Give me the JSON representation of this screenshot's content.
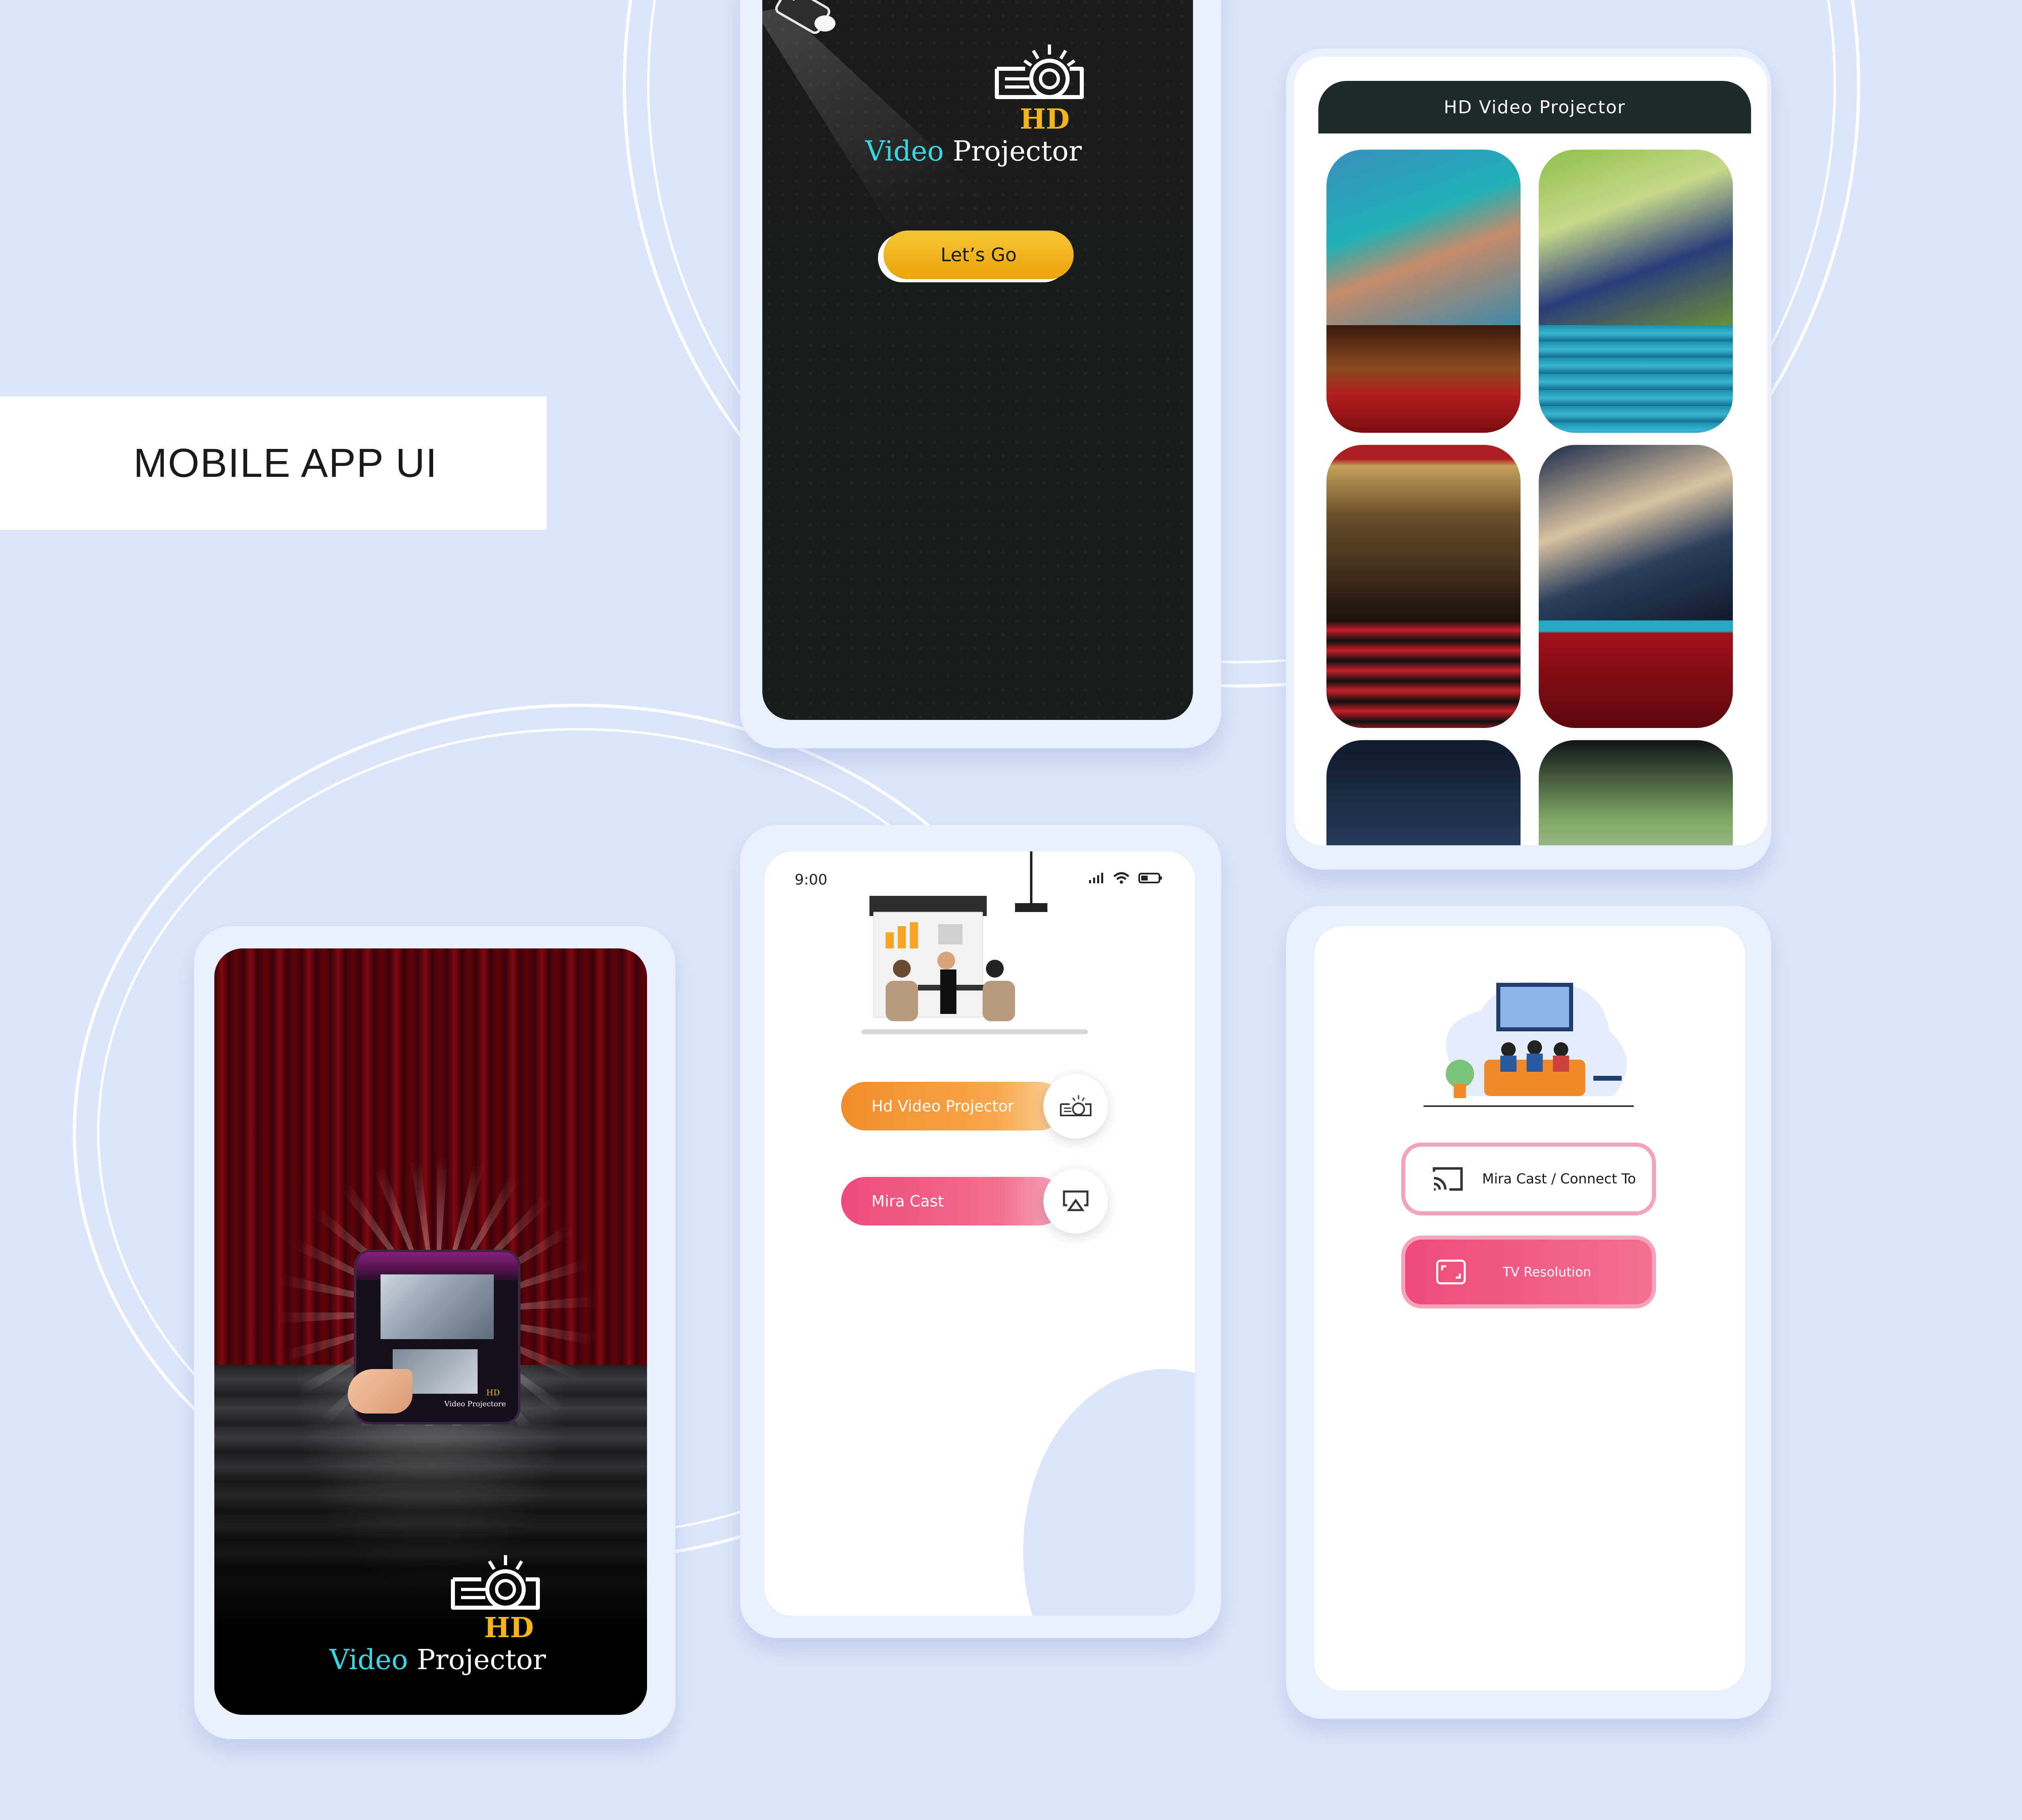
{
  "page": {
    "label": "MOBILE APP UI"
  },
  "splash": {
    "hd": "HD",
    "video": "Video",
    "projector": "Projector",
    "button": "Let’s Go"
  },
  "grid": {
    "title": "HD Video Projector"
  },
  "curtain": {
    "hd": "HD",
    "video": "Video",
    "projector": "Projector",
    "mini_label": "Video Projectore",
    "mini_hd": "HD"
  },
  "menu": {
    "time": "9:00",
    "items": [
      {
        "label": "Hd Video Projector",
        "icon": "projector-icon",
        "color": "#f28c2b"
      },
      {
        "label": "Mira Cast",
        "icon": "airplay-icon",
        "color": "#ee4a7b"
      }
    ]
  },
  "connect": {
    "items": [
      {
        "label": "Mira Cast / Connect To",
        "icon": "cast-icon"
      },
      {
        "label": "TV Resolution",
        "icon": "resize-icon"
      }
    ]
  },
  "colors": {
    "background": "#dce6fb",
    "accent_yellow": "#f3b51b",
    "accent_cyan": "#3ad7e2",
    "pink": "#ee4a7b",
    "orange": "#f28c2b"
  }
}
